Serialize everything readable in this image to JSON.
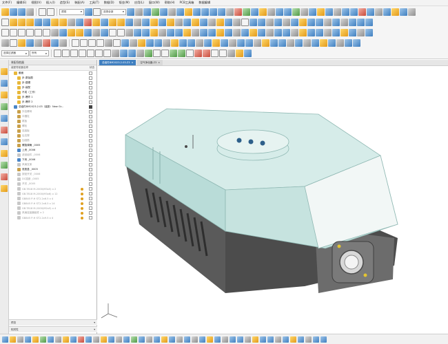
{
  "menu": [
    "文件(F)",
    "编辑(E)",
    "视图(V)",
    "插入(I)",
    "造型(S)",
    "装配(A)",
    "工具(T)",
    "数据(D)",
    "钣金(M)",
    "应用(L)",
    "窗口(W)",
    "帮助(H)",
    "PCB工具箱",
    "数据编辑"
  ],
  "toolbar": {
    "view_combo": "透视",
    "filter_combo": "选择全部",
    "filter_combo2": "选择过滤器",
    "all_combo": "所有"
  },
  "panel": {
    "title": "装配导航器",
    "header_name": "装配导航器名称",
    "header_col": "状态",
    "footer1": "预览",
    "footer2": "相关性"
  },
  "tree": [
    {
      "label": "截面",
      "indent": 1,
      "icon": "folder",
      "style": "bold",
      "check": false,
      "warn": false
    },
    {
      "label": "步-原始图",
      "indent": 2,
      "icon": "folder",
      "style": "bold",
      "check": false,
      "warn": false
    },
    {
      "label": "步-建模",
      "indent": 2,
      "icon": "folder",
      "style": "bold",
      "check": false,
      "warn": false
    },
    {
      "label": "步-装配",
      "indent": 2,
      "icon": "folder",
      "style": "bold",
      "check": false,
      "warn": false
    },
    {
      "label": "不成（工作）",
      "indent": 2,
      "icon": "folder",
      "style": "bold",
      "check": false,
      "warn": false
    },
    {
      "label": "步-爆炸 1",
      "indent": 2,
      "icon": "folder",
      "style": "bold",
      "check": false,
      "warn": false
    },
    {
      "label": "步-爆炸 2",
      "indent": 2,
      "icon": "folder",
      "style": "bold",
      "check": false,
      "warn": false
    },
    {
      "label": "总组件BM2023.2.03（装配：New Gr...",
      "indent": 1,
      "icon": "part",
      "style": "bold",
      "check": true,
      "warn": false
    },
    {
      "label": "外挂螺母",
      "indent": 2,
      "icon": "feat",
      "style": "dim",
      "check": false,
      "warn": false
    },
    {
      "label": "半圆柱",
      "indent": 2,
      "icon": "feat",
      "style": "dim",
      "check": false,
      "warn": false
    },
    {
      "label": "尾板",
      "indent": 2,
      "icon": "feat",
      "style": "dim",
      "check": false,
      "warn": false
    },
    {
      "label": "螺栓",
      "indent": 2,
      "icon": "feat",
      "style": "dim",
      "check": false,
      "warn": false
    },
    {
      "label": "连接板",
      "indent": 2,
      "icon": "feat",
      "style": "dim",
      "check": false,
      "warn": false
    },
    {
      "label": "后支撑",
      "indent": 2,
      "icon": "feat",
      "style": "dim",
      "check": false,
      "warn": false
    },
    {
      "label": "加强筋",
      "indent": 2,
      "icon": "feat",
      "style": "dim",
      "check": false,
      "warn": false
    },
    {
      "label": "螺旋弹簧 _0005",
      "indent": 2,
      "icon": "feat",
      "style": "bold",
      "check": false,
      "warn": false
    },
    {
      "label": "上壳 _0006",
      "indent": 2,
      "icon": "part",
      "style": "bold",
      "check": false,
      "warn": false
    },
    {
      "label": "滤波组件 _0006",
      "indent": 2,
      "icon": "grey",
      "style": "dim",
      "check": false,
      "warn": false
    },
    {
      "label": "下壳 _0006",
      "indent": 2,
      "icon": "part",
      "style": "bold",
      "check": false,
      "warn": false
    },
    {
      "label": "风扇支架",
      "indent": 2,
      "icon": "grey",
      "style": "dim",
      "check": false,
      "warn": false
    },
    {
      "label": "底座盒 _0005",
      "indent": 2,
      "icon": "feat",
      "style": "bold",
      "check": false,
      "warn": false
    },
    {
      "label": "按钮开关 _0006",
      "indent": 2,
      "icon": "grey",
      "style": "dim",
      "check": false,
      "warn": false
    },
    {
      "label": "DC插座 _0005",
      "indent": 2,
      "icon": "grey",
      "style": "dim",
      "check": false,
      "warn": false
    },
    {
      "label": "开关 _0005",
      "indent": 2,
      "icon": "grey",
      "style": "dim",
      "check": false,
      "warn": false
    },
    {
      "label": "GB-T818 M-2000(M3x5) x 2",
      "indent": 2,
      "icon": "grey",
      "style": "dim",
      "check": false,
      "warn": true
    },
    {
      "label": "GB-T818 M-2000(M3x6) x 12",
      "indent": 2,
      "icon": "grey",
      "style": "dim",
      "check": false,
      "warn": true
    },
    {
      "label": "GB845 P-H ST2.2x6.5 x 4",
      "indent": 2,
      "icon": "grey",
      "style": "dim",
      "check": false,
      "warn": true
    },
    {
      "label": "GB845 P-H ST2.2x6.5 x 14",
      "indent": 2,
      "icon": "grey",
      "style": "dim",
      "check": false,
      "warn": true
    },
    {
      "label": "GB-T818 M-2000(M2x5) x 4",
      "indent": 2,
      "icon": "grey",
      "style": "dim",
      "check": false,
      "warn": true
    },
    {
      "label": "风扇连接器组件 x 2",
      "indent": 2,
      "icon": "grey",
      "style": "dim",
      "check": false,
      "warn": true
    },
    {
      "label": "GB845 P-H ST2.2x9.5 x 4",
      "indent": 2,
      "icon": "grey",
      "style": "dim",
      "check": false,
      "warn": true
    }
  ],
  "tabs": [
    {
      "label": "总组件BM2023.2.03.Z3",
      "active": true
    },
    {
      "label": "空气净化器.Z3",
      "active": false
    }
  ],
  "colors": {
    "body_top": "#d6ece9",
    "body_side": "#b9dcd8",
    "base_dark": "#4f4f4f",
    "base_mid": "#6a6a6a",
    "accent_blue": "#3f7fc0"
  }
}
